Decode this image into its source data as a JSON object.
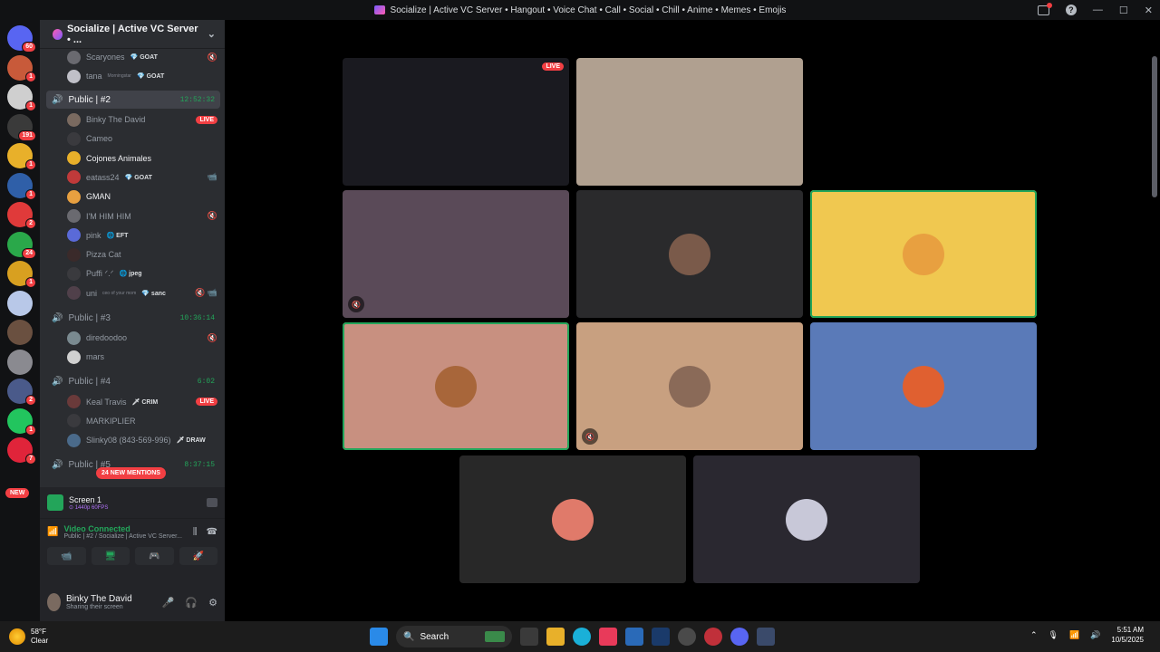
{
  "window": {
    "title": "Socialize | Active VC Server • Hangout • Voice Chat • Call • Social • Chill • Anime • Memes • Emojis"
  },
  "rail": {
    "servers": [
      {
        "color": "#5865f2",
        "badge": "60"
      },
      {
        "color": "#c85a3a",
        "badge": "1"
      },
      {
        "color": "#cfcfcf",
        "badge": "1"
      },
      {
        "color": "#3a3a3a",
        "badge": "191"
      },
      {
        "color": "#e8b02a",
        "badge": "1"
      },
      {
        "color": "#2f5fa8",
        "badge": "1"
      },
      {
        "color": "#e03a3a",
        "badge": "2"
      },
      {
        "color": "#2aa84a",
        "badge": "24"
      },
      {
        "color": "#d8a020",
        "badge": "1"
      },
      {
        "color": "#b8c8e8",
        "badge": ""
      },
      {
        "color": "#6a5040",
        "badge": ""
      },
      {
        "color": "#8a8a90",
        "badge": ""
      },
      {
        "color": "#4a5a8a",
        "badge": "2"
      },
      {
        "color": "#22c55e",
        "badge": "1"
      },
      {
        "color": "#e0243a",
        "badge": "7"
      }
    ],
    "new_label": "NEW"
  },
  "server": {
    "name": "Socialize | Active VC Server • ..."
  },
  "voice": {
    "top_users": [
      {
        "name": "Scaryones",
        "tag": "💎 GOAT",
        "color": "#6a6a70",
        "icon": "🔇"
      },
      {
        "name": "tana",
        "sub": "Morningstar",
        "tag": "💎 GOAT",
        "color": "#c0c0c8",
        "icon": ""
      }
    ],
    "channels": [
      {
        "name": "Public | #2",
        "time": "12:52:32",
        "selected": true,
        "users": [
          {
            "name": "Binky The David",
            "tag": "",
            "color": "#7a6a60",
            "live": "LIVE",
            "icon": "📹",
            "active": false
          },
          {
            "name": "Cameo",
            "tag": "",
            "color": "#3a3a3e",
            "live": "",
            "icon": "",
            "active": false
          },
          {
            "name": "Cojones Animales",
            "tag": "",
            "color": "#e8b02a",
            "live": "",
            "icon": "",
            "active": true
          },
          {
            "name": "eatass24",
            "tag": "💎 GOAT",
            "color": "#c03a3a",
            "live": "",
            "icon": "📹",
            "active": false
          },
          {
            "name": "GMAN",
            "tag": "",
            "color": "#e8a040",
            "live": "",
            "icon": "",
            "active": true
          },
          {
            "name": "I'M HIM HIM",
            "tag": "",
            "color": "#6a6a70",
            "live": "",
            "icon": "🔇",
            "active": false
          },
          {
            "name": "pink",
            "tag": "🌐 EFT",
            "color": "#5a6ad8",
            "live": "",
            "icon": "",
            "active": false
          },
          {
            "name": "Pizza Cat",
            "tag": "",
            "color": "#3a2a2a",
            "live": "",
            "icon": "",
            "active": false
          },
          {
            "name": "Puffi ᐟ.ᐟ",
            "tag": "🌐 jpeg",
            "color": "#3a3a3e",
            "live": "",
            "icon": "",
            "active": false
          },
          {
            "name": "uni",
            "sub": "ceo of your mom",
            "tag": "💎 sanc",
            "color": "#50404a",
            "live": "",
            "icon": "🔇 📹",
            "active": false
          }
        ]
      },
      {
        "name": "Public | #3",
        "time": "10:36:14",
        "selected": false,
        "users": [
          {
            "name": "diredoodoo",
            "tag": "",
            "color": "#7a8a90",
            "live": "",
            "icon": "🔇",
            "active": false
          },
          {
            "name": "mars",
            "tag": "",
            "color": "#d0d0d0",
            "live": "",
            "icon": "",
            "active": false
          }
        ]
      },
      {
        "name": "Public | #4",
        "time": "6:02",
        "selected": false,
        "users": [
          {
            "name": "Keal Travis",
            "tag": "🗡 CRIM",
            "color": "#6a3a3a",
            "live": "LIVE",
            "icon": "",
            "active": false
          },
          {
            "name": "MARKIPLIER",
            "tag": "",
            "color": "#3a3a3e",
            "live": "",
            "icon": "",
            "active": false
          },
          {
            "name": "Slinky08 (843-569-996)",
            "tag": "🗡 DRAW",
            "color": "#4a6a8a",
            "live": "",
            "icon": "",
            "active": false
          }
        ]
      },
      {
        "name": "Public | #5",
        "time": "8:37:15",
        "selected": false,
        "users": []
      }
    ],
    "mentions": "24 NEW MENTIONS"
  },
  "screen": {
    "title": "Screen 1",
    "sub": "⊙ 1440p 60FPS"
  },
  "connection": {
    "status": "Video Connected",
    "location": "Public | #2 / Socialize | Active VC Server...",
    "buttons": [
      "📹",
      "🖥",
      "🎮",
      "🚀"
    ]
  },
  "user": {
    "name": "Binky The David",
    "status": "Sharing their screen"
  },
  "tiles": [
    {
      "bg": "#1a1a20",
      "label": "screen-share",
      "live": "LIVE",
      "speaking": false,
      "muted": false,
      "av": ""
    },
    {
      "bg": "#b0a090",
      "label": "webcam-man",
      "live": "",
      "speaking": false,
      "muted": false,
      "av": ""
    },
    {
      "bg": "#000000",
      "label": "dashcam",
      "live": "",
      "speaking": false,
      "muted": false,
      "av": ""
    },
    {
      "bg": "#5a4a58",
      "label": "webcam-woman",
      "live": "",
      "speaking": false,
      "muted": true,
      "av": ""
    },
    {
      "bg": "#2a2a2c",
      "label": "avatar-shirtless",
      "live": "",
      "speaking": false,
      "muted": false,
      "av": "#7a5a4a"
    },
    {
      "bg": "#f0c850",
      "label": "avatar-cartoon",
      "live": "",
      "speaking": true,
      "muted": false,
      "av": "#e8a040"
    },
    {
      "bg": "#c89080",
      "label": "avatar-toad",
      "live": "",
      "speaking": true,
      "muted": false,
      "av": "#a8663a"
    },
    {
      "bg": "#c8a080",
      "label": "avatar-selfie",
      "live": "",
      "speaking": false,
      "muted": true,
      "av": "#8a6a58"
    },
    {
      "bg": "#5a7ab8",
      "label": "avatar-sonny",
      "live": "",
      "speaking": false,
      "muted": false,
      "av": "#e06030"
    },
    {
      "bg": "#282828",
      "label": "avatar-pizza-cat",
      "live": "",
      "speaking": false,
      "muted": false,
      "av": "#e07a6a"
    },
    {
      "bg": "#2a2830",
      "label": "avatar-anime",
      "live": "",
      "speaking": false,
      "muted": false,
      "av": "#c8c8d8"
    }
  ],
  "taskbar": {
    "temp": "58°F",
    "weather": "Clear",
    "search": "Search",
    "time": "5:51 AM",
    "date": "10/5/2025"
  }
}
